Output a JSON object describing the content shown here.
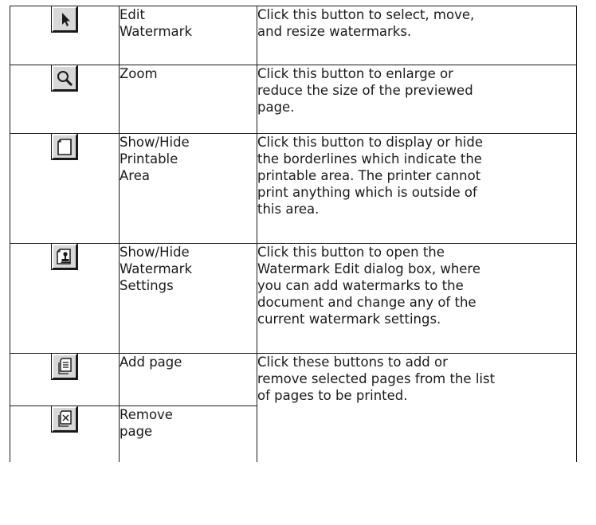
{
  "rows": [
    {
      "icon": "arrow-pointer-icon",
      "name": "Edit\nWatermark",
      "desc": "Click this button to select, move,\nand resize watermarks."
    },
    {
      "icon": "magnifier-icon",
      "name": "Zoom",
      "desc": "Click this button to enlarge or\nreduce the size of the previewed\npage."
    },
    {
      "icon": "blank-page-icon",
      "name": "Show/Hide\nPrintable\nArea",
      "desc": "Click this button to display or hide\nthe borderlines which indicate the\nprintable area. The printer cannot\nprint anything which is outside of\nthis area."
    },
    {
      "icon": "watermark-stamp-icon",
      "name": "Show/Hide\nWatermark\nSettings",
      "desc": "Click this button to open the\nWatermark Edit dialog box, where\nyou can add watermarks to the\ndocument and change any of the\ncurrent watermark settings."
    },
    {
      "icon": "add-page-icon",
      "name": "Add page",
      "desc": "Click these buttons to add or\nremove selected pages from the list\nof pages to be printed."
    },
    {
      "icon": "remove-page-icon",
      "name": "Remove\npage"
    }
  ]
}
